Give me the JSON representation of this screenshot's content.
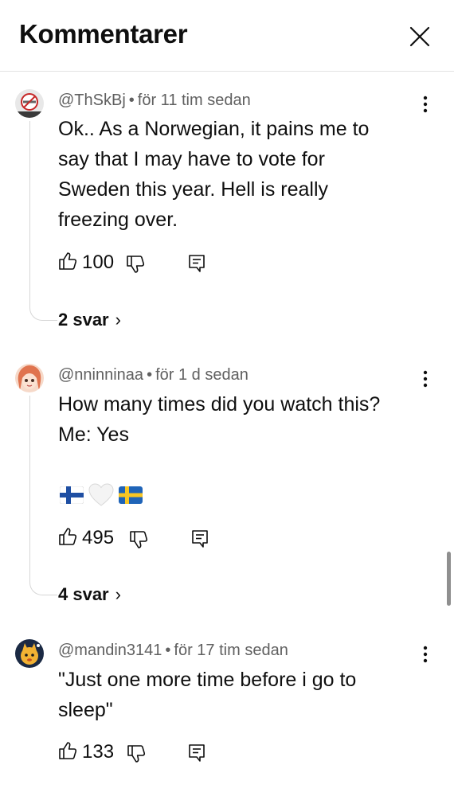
{
  "header": {
    "title": "Kommentarer",
    "close_icon": "close-icon"
  },
  "comments": [
    {
      "author": "@ThSkBj",
      "time": "för 11 tim sedan",
      "lines": [
        "Ok.. As a Norwegian, it pains me to",
        "say that I may have to vote for",
        "Sweden this year. Hell is really",
        "freezing over."
      ],
      "likes": "100",
      "replies": "2 svar",
      "avatar_icon": "no-smoking-icon"
    },
    {
      "author": "@nninninaa",
      "time": "för 1 d sedan",
      "lines": [
        "How many times did you watch this?",
        "Me: Yes"
      ],
      "emoji": [
        "finland-flag-icon",
        "white-heart-icon",
        "sweden-flag-icon"
      ],
      "likes": "495",
      "replies": "4 svar",
      "avatar_icon": "anime-girl-avatar-icon"
    },
    {
      "author": "@mandin3141",
      "time": "för 17 tim sedan",
      "lines": [
        "\"Just one more time before i go to",
        "sleep\""
      ],
      "likes": "133",
      "avatar_icon": "cartoon-avatar-icon"
    }
  ],
  "colors": {
    "text": "#0f0f0f",
    "meta": "#606060",
    "divider": "#e3e3e3"
  }
}
